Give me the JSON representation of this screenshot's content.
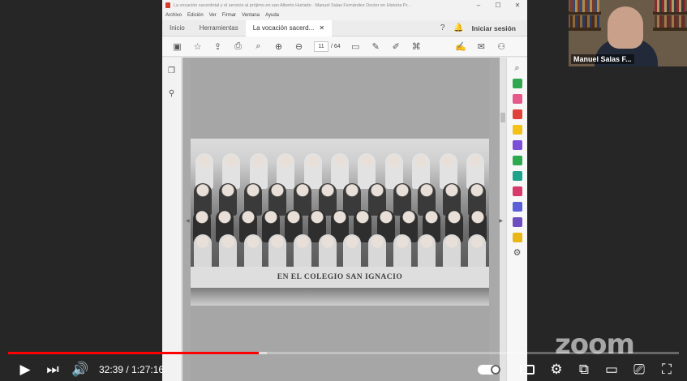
{
  "acrobat": {
    "window_title": "La vocación sacerdotal y el servicio al prójimo en san Alberto Hurtado · Manuel Salas Fernández Doctor en Historia Pr...",
    "menu": [
      "Archivo",
      "Edición",
      "Ver",
      "Firmar",
      "Ventana",
      "Ayuda"
    ],
    "tabs": {
      "home": "Inicio",
      "tools": "Herramientas",
      "document": "La vocación sacerd..."
    },
    "login_label": "Iniciar sesión",
    "page_current": "11",
    "page_total": "/ 64",
    "doc_caption": "EN EL COLEGIO SAN IGNACIO"
  },
  "webcam": {
    "participant_name": "Manuel Salas F..."
  },
  "player": {
    "timecode": "32:39 / 1:27:16",
    "played_fraction": 0.374,
    "loaded_fraction": 0.012,
    "logo_text": "zoom"
  },
  "colors": {
    "progress_played": "#ff0000",
    "acrobat_accent": "#d63a2f"
  },
  "icons": {
    "toolbar": [
      "save-icon",
      "star-icon",
      "upload-icon",
      "print-icon",
      "zoom-out-icon",
      "page-up-icon",
      "page-down-icon",
      "comment-icon",
      "pen-icon",
      "highlight-icon",
      "stamp-icon",
      "sign-icon",
      "mail-icon",
      "share-icon"
    ],
    "right_rail": [
      "zoom-in-icon",
      "export-pdf-icon",
      "edit-pdf-icon",
      "create-pdf-icon",
      "comment-icon",
      "combine-icon",
      "organize-icon",
      "scan-icon",
      "fill-sign-icon",
      "protect-icon",
      "send-sign-icon",
      "more-tools-icon",
      "settings-icon"
    ]
  }
}
